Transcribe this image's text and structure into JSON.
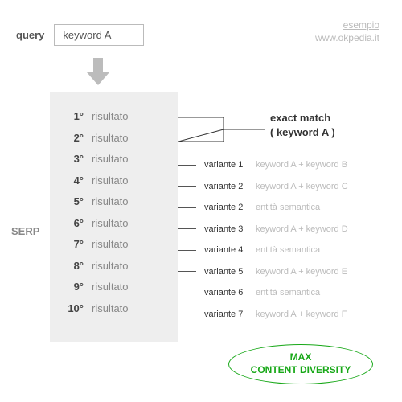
{
  "query": {
    "label": "query",
    "value": "keyword A"
  },
  "credit": {
    "line1": "esempio",
    "line2": "www.okpedia.it"
  },
  "serp": {
    "label": "SERP",
    "result_word": "risultato",
    "rows": [
      {
        "rank": "1°"
      },
      {
        "rank": "2°"
      },
      {
        "rank": "3°"
      },
      {
        "rank": "4°"
      },
      {
        "rank": "5°"
      },
      {
        "rank": "6°"
      },
      {
        "rank": "7°"
      },
      {
        "rank": "8°"
      },
      {
        "rank": "9°"
      },
      {
        "rank": "10°"
      }
    ]
  },
  "exact_match": {
    "line1": "exact match",
    "line2": "( keyword A )"
  },
  "variants": [
    {
      "label": "variante 1",
      "detail": "keyword A + keyword B"
    },
    {
      "label": "variante 2",
      "detail": "keyword A + keyword C"
    },
    {
      "label": "variante 2",
      "detail": "entità semantica"
    },
    {
      "label": "variante 3",
      "detail": "keyword A + keyword D"
    },
    {
      "label": "variante 4",
      "detail": "entità semantica"
    },
    {
      "label": "variante 5",
      "detail": "keyword A + keyword E"
    },
    {
      "label": "variante 6",
      "detail": "entità semantica"
    },
    {
      "label": "variante 7",
      "detail": "keyword A + keyword F"
    }
  ],
  "oval": {
    "line1": "MAX",
    "line2": "CONTENT DIVERSITY"
  }
}
